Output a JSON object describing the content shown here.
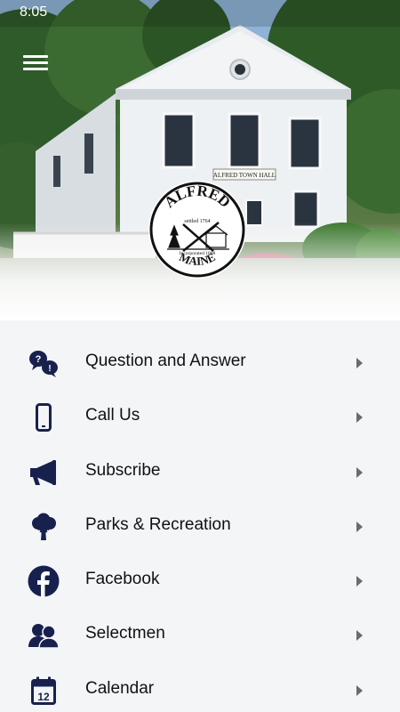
{
  "status_bar": {
    "time": "8:05"
  },
  "header": {
    "menu_icon": "hamburger-menu-icon",
    "building_sign": "ALFRED TOWN HALL",
    "seal": {
      "name_text": "ALFRED",
      "state_text": "MAINE",
      "settled_text": "settled 1764",
      "incorporated_text": "Incorporated 1808"
    }
  },
  "menu": {
    "items": [
      {
        "label": "Question and Answer",
        "icon": "question-answer-icon"
      },
      {
        "label": "Call Us",
        "icon": "phone-icon"
      },
      {
        "label": "Subscribe",
        "icon": "megaphone-icon"
      },
      {
        "label": "Parks & Recreation",
        "icon": "tree-icon"
      },
      {
        "label": "Facebook",
        "icon": "facebook-icon"
      },
      {
        "label": "Selectmen",
        "icon": "people-icon"
      },
      {
        "label": "Calendar",
        "icon": "calendar-icon"
      }
    ]
  },
  "colors": {
    "icon": "#18214d",
    "arrow": "#6b6b6b",
    "background": "#f4f5f7"
  }
}
